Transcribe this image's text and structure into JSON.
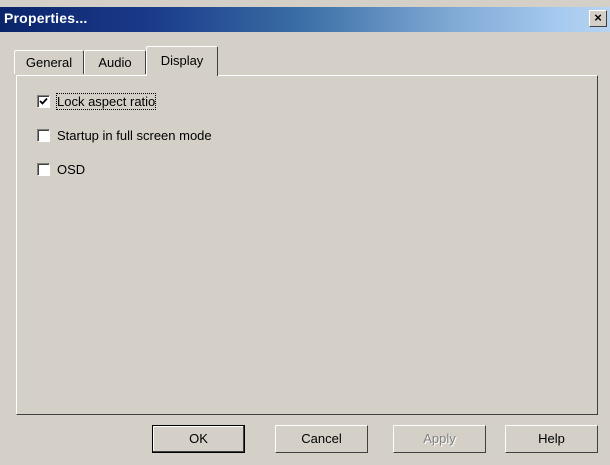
{
  "window": {
    "title": "Properties...",
    "close_glyph": "×"
  },
  "tabs": [
    {
      "label": "General",
      "active": false
    },
    {
      "label": "Audio",
      "active": false
    },
    {
      "label": "Display",
      "active": true
    }
  ],
  "options": [
    {
      "label": "Lock aspect ratio",
      "checked": true,
      "focused": true
    },
    {
      "label": "Startup in full screen mode",
      "checked": false,
      "focused": false
    },
    {
      "label": "OSD",
      "checked": false,
      "focused": false
    }
  ],
  "buttons": {
    "ok": "OK",
    "cancel": "Cancel",
    "apply": "Apply",
    "help": "Help"
  },
  "icons": {
    "close": "close-icon",
    "check": "checkmark-icon"
  },
  "colors": {
    "face": "#d4d0c8",
    "title_start": "#0a246a",
    "title_end": "#b8d4f0",
    "disabled_text": "#808080"
  }
}
